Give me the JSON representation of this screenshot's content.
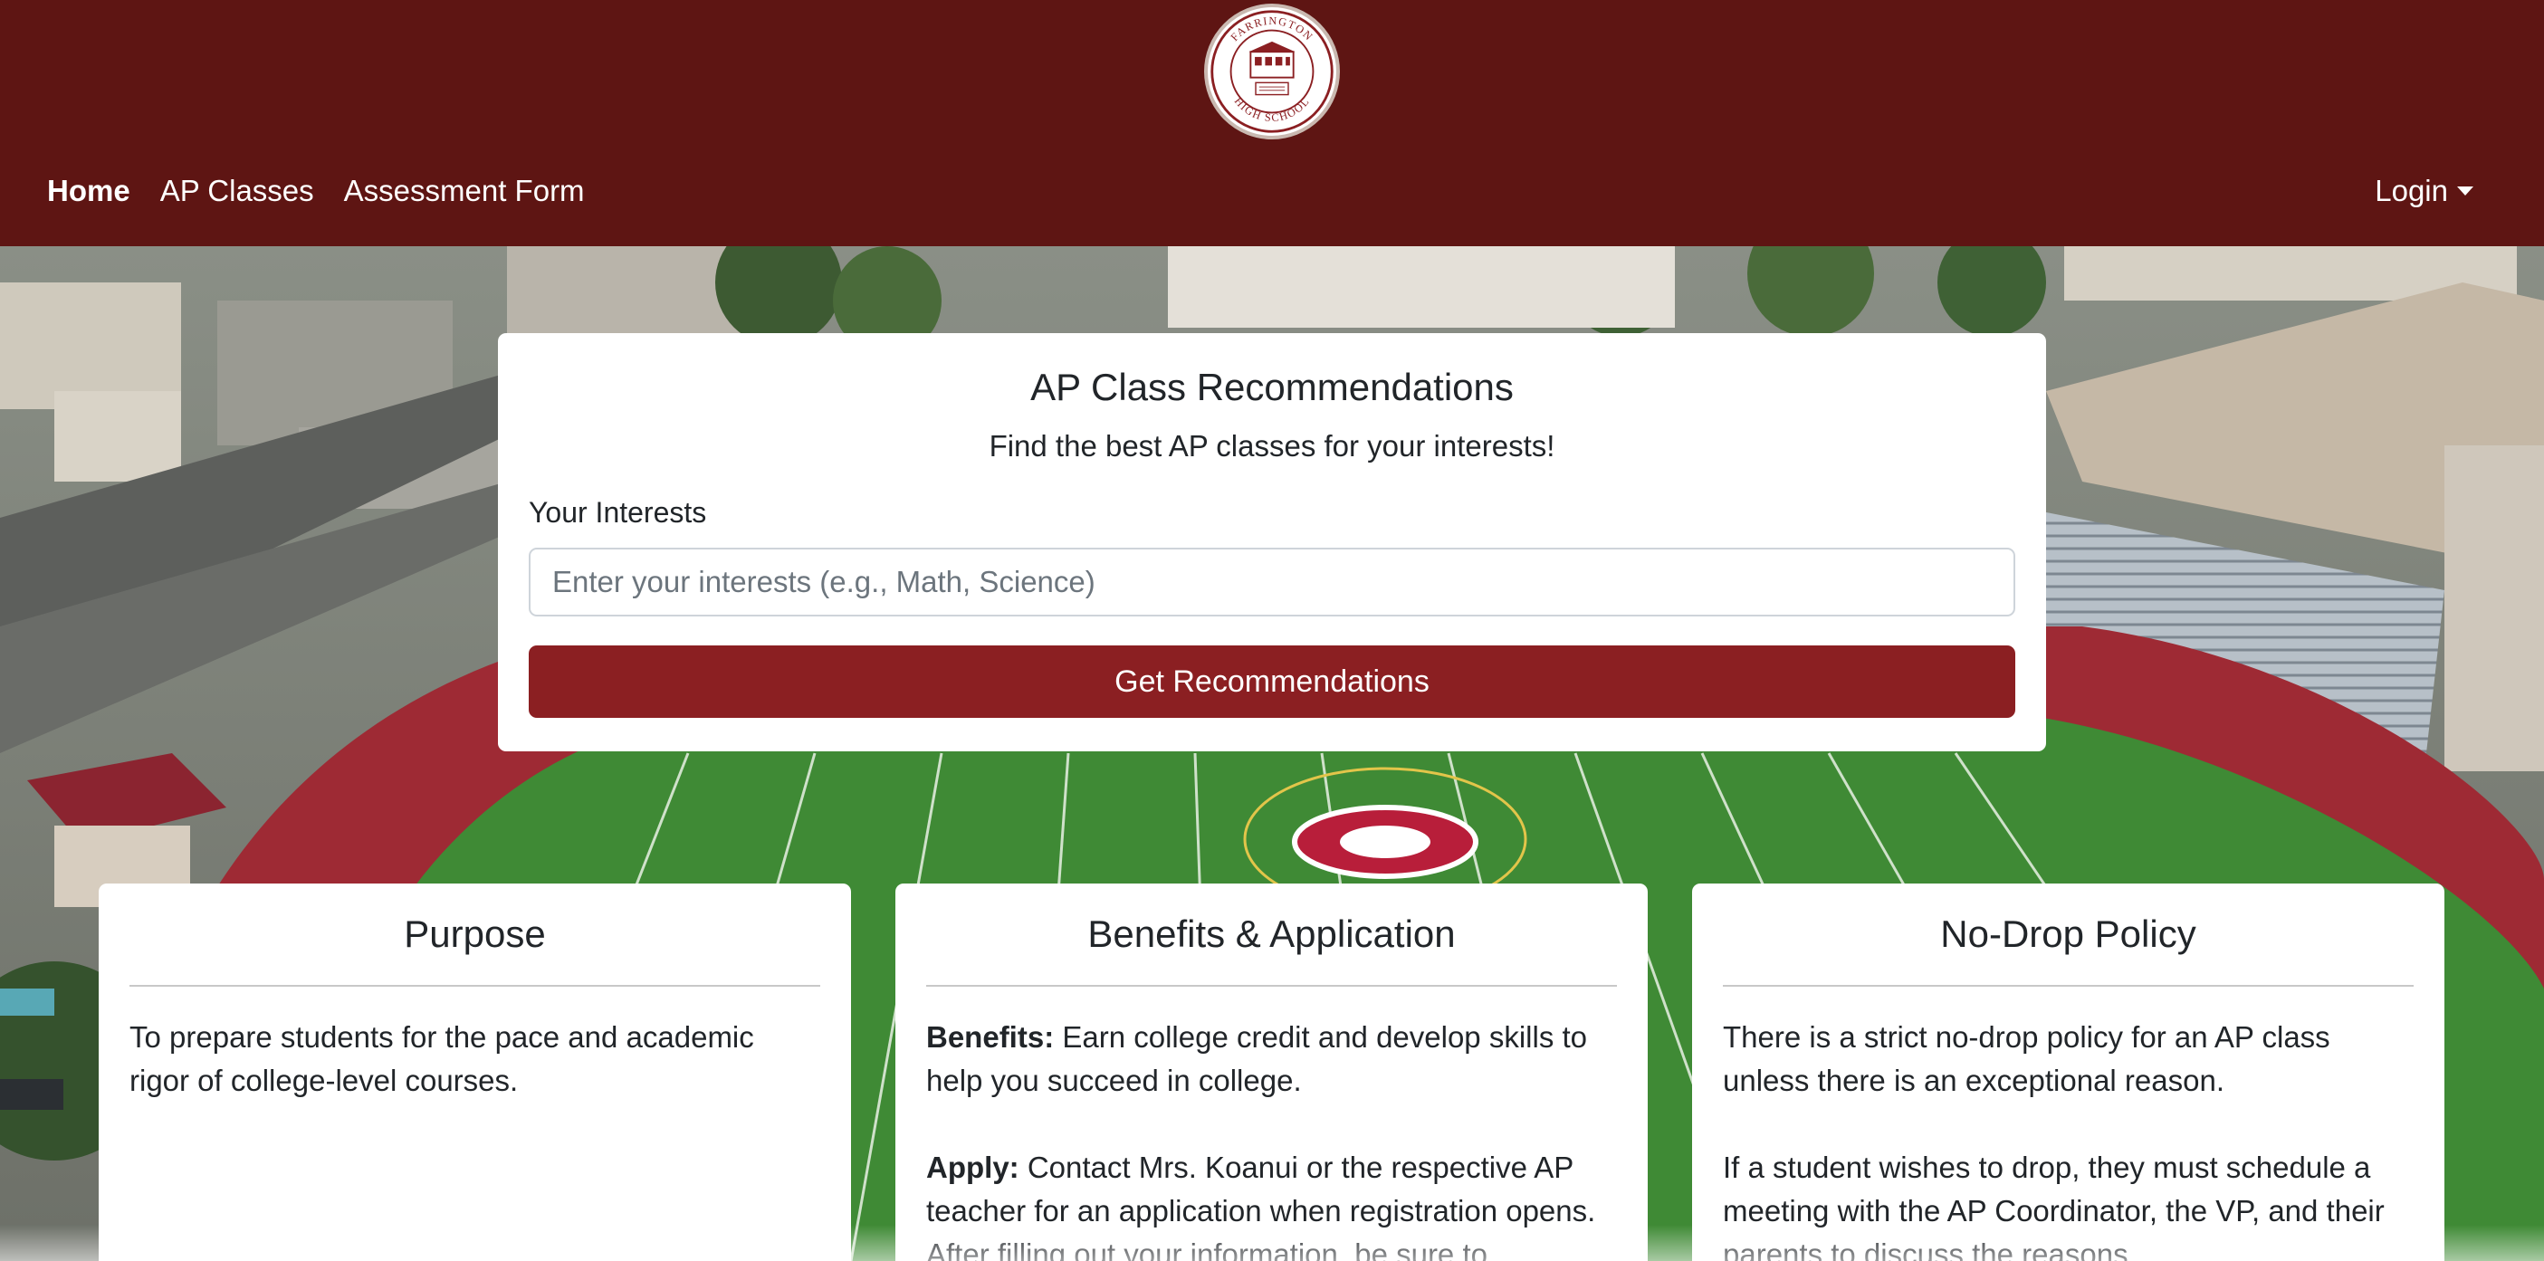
{
  "brand": {
    "logo_alt": "Farrington High School",
    "logo_text_top": "FARRINGTON",
    "logo_text_bottom": "HIGH SCHOOL"
  },
  "nav": {
    "links": [
      {
        "label": "Home",
        "active": true
      },
      {
        "label": "AP Classes",
        "active": false
      },
      {
        "label": "Assessment Form",
        "active": false
      }
    ],
    "login_label": "Login"
  },
  "search": {
    "title": "AP Class Recommendations",
    "subtitle": "Find the best AP classes for your interests!",
    "field_label": "Your Interests",
    "placeholder": "Enter your interests (e.g., Math, Science)",
    "value": "",
    "button_label": "Get Recommendations"
  },
  "cards": [
    {
      "title": "Purpose",
      "text": "To prepare students for the pace and academic rigor of college-level courses."
    },
    {
      "title": "Benefits & Application",
      "benefits_label": "Benefits:",
      "benefits_text": " Earn college credit and develop skills to help you succeed in college.",
      "apply_label": "Apply:",
      "apply_text": " Contact Mrs. Koanui or the respective AP teacher for an application when registration opens. After filling out your information, be sure to"
    },
    {
      "title": "No-Drop Policy",
      "text": "There is a strict no-drop policy for an AP class unless there is an exceptional reason.",
      "text2": "If a student wishes to drop, they must schedule a meeting with the AP Coordinator, the VP, and their parents to discuss the reasons."
    }
  ],
  "colors": {
    "header_bg": "#5e1513",
    "button_bg": "#8b1f22",
    "track": "#9e2a34",
    "field": "#3f8a35"
  },
  "icons": {
    "login_caret": "chevron-down-icon"
  }
}
